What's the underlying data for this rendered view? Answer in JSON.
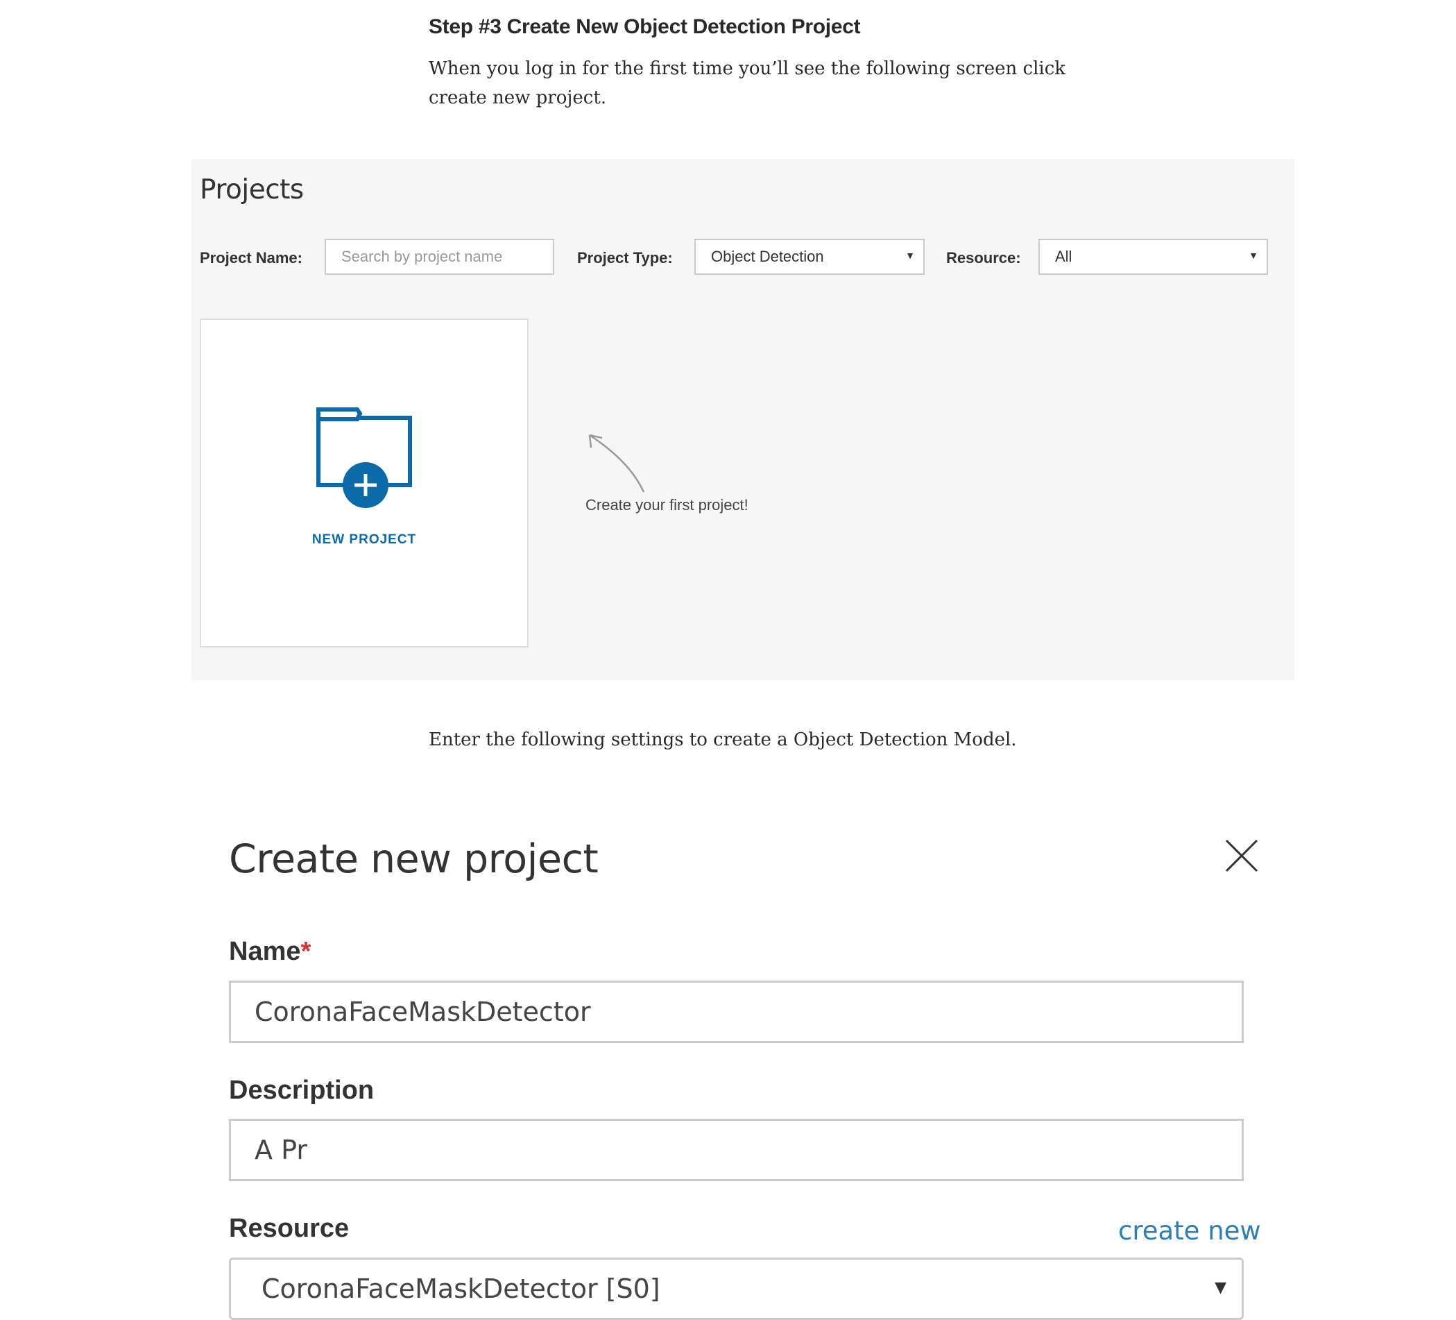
{
  "article": {
    "step_heading": "Step #3 Create New Object Detection Project",
    "intro_text": "When you log in for the first time you’ll see the following screen click create new project.",
    "settings_text": "Enter the following settings to create a Object Detection Model."
  },
  "projects_page": {
    "title": "Projects",
    "filters": {
      "name_label": "Project Name:",
      "name_placeholder": "Search by project name",
      "type_label": "Project Type:",
      "type_value": "Object Detection",
      "resource_label": "Resource:",
      "resource_value": "All"
    },
    "new_project_label": "NEW PROJECT",
    "hint_text": "Create your first project!"
  },
  "create_dialog": {
    "title": "Create new project",
    "name_label": "Name",
    "required_marker": "*",
    "name_value": "CoronaFaceMaskDetector",
    "description_label": "Description",
    "description_value": "A Pr",
    "resource_label": "Resource",
    "create_new_link": "create new",
    "resource_value": "CoronaFaceMaskDetector [S0]"
  },
  "colors": {
    "accent_blue": "#0b6aa8",
    "link_blue": "#2c7fb6",
    "required_red": "#d63333",
    "panel_bg": "#f6f6f6"
  },
  "icons": {
    "new_project": "folder-plus-icon",
    "close": "close-icon",
    "dropdown": "chevron-down-icon",
    "hint": "curved-arrow-icon"
  }
}
